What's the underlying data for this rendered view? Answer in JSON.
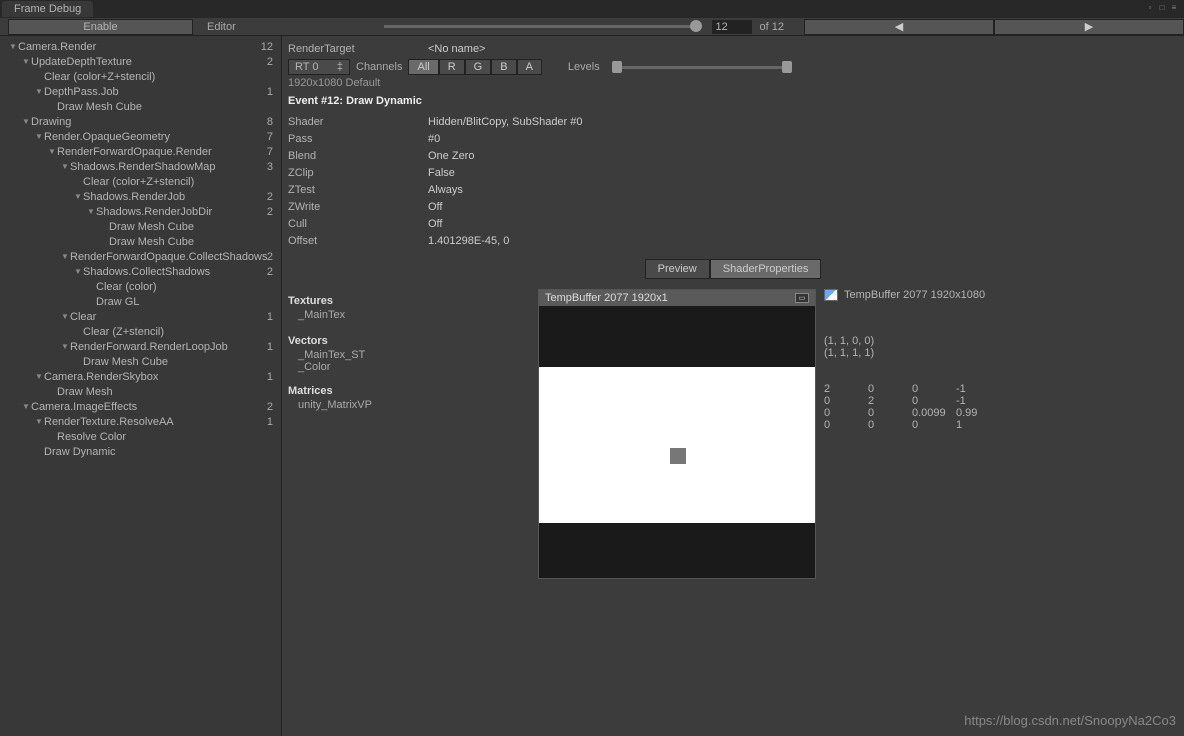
{
  "tab_title": "Frame Debug",
  "toolbar": {
    "enable_label": "Enable",
    "editor_label": "Editor",
    "frame_current": "12",
    "frame_total": "of 12",
    "prev_arrow": "◀",
    "next_arrow": "▶"
  },
  "tree": [
    {
      "indent": 0,
      "arrow": true,
      "label": "Camera.Render",
      "count": "12"
    },
    {
      "indent": 1,
      "arrow": true,
      "label": "UpdateDepthTexture",
      "count": "2"
    },
    {
      "indent": 2,
      "arrow": false,
      "label": "Clear (color+Z+stencil)",
      "count": ""
    },
    {
      "indent": 2,
      "arrow": true,
      "label": "DepthPass.Job",
      "count": "1"
    },
    {
      "indent": 3,
      "arrow": false,
      "label": "Draw Mesh Cube",
      "count": ""
    },
    {
      "indent": 1,
      "arrow": true,
      "label": "Drawing",
      "count": "8"
    },
    {
      "indent": 2,
      "arrow": true,
      "label": "Render.OpaqueGeometry",
      "count": "7"
    },
    {
      "indent": 3,
      "arrow": true,
      "label": "RenderForwardOpaque.Render",
      "count": "7"
    },
    {
      "indent": 4,
      "arrow": true,
      "label": "Shadows.RenderShadowMap",
      "count": "3"
    },
    {
      "indent": 5,
      "arrow": false,
      "label": "Clear (color+Z+stencil)",
      "count": ""
    },
    {
      "indent": 5,
      "arrow": true,
      "label": "Shadows.RenderJob",
      "count": "2"
    },
    {
      "indent": 6,
      "arrow": true,
      "label": "Shadows.RenderJobDir",
      "count": "2"
    },
    {
      "indent": 7,
      "arrow": false,
      "label": "Draw Mesh Cube",
      "count": ""
    },
    {
      "indent": 7,
      "arrow": false,
      "label": "Draw Mesh Cube",
      "count": ""
    },
    {
      "indent": 4,
      "arrow": true,
      "label": "RenderForwardOpaque.CollectShadows",
      "count": "2"
    },
    {
      "indent": 5,
      "arrow": true,
      "label": "Shadows.CollectShadows",
      "count": "2"
    },
    {
      "indent": 6,
      "arrow": false,
      "label": "Clear (color)",
      "count": ""
    },
    {
      "indent": 6,
      "arrow": false,
      "label": "Draw GL",
      "count": ""
    },
    {
      "indent": 4,
      "arrow": true,
      "label": "Clear",
      "count": "1"
    },
    {
      "indent": 5,
      "arrow": false,
      "label": "Clear (Z+stencil)",
      "count": ""
    },
    {
      "indent": 4,
      "arrow": true,
      "label": "RenderForward.RenderLoopJob",
      "count": "1"
    },
    {
      "indent": 5,
      "arrow": false,
      "label": "Draw Mesh Cube",
      "count": ""
    },
    {
      "indent": 2,
      "arrow": true,
      "label": "Camera.RenderSkybox",
      "count": "1"
    },
    {
      "indent": 3,
      "arrow": false,
      "label": "Draw Mesh",
      "count": ""
    },
    {
      "indent": 1,
      "arrow": true,
      "label": "Camera.ImageEffects",
      "count": "2"
    },
    {
      "indent": 2,
      "arrow": true,
      "label": "RenderTexture.ResolveAA",
      "count": "1"
    },
    {
      "indent": 3,
      "arrow": false,
      "label": "Resolve Color",
      "count": ""
    },
    {
      "indent": 2,
      "arrow": false,
      "label": "Draw Dynamic",
      "count": ""
    }
  ],
  "detail": {
    "render_target_label": "RenderTarget",
    "render_target_value": "<No name>",
    "rt_dropdown": "RT 0",
    "channels_label": "Channels",
    "channels": [
      "All",
      "R",
      "G",
      "B",
      "A"
    ],
    "levels_label": "Levels",
    "resolution": "1920x1080 Default",
    "event_title": "Event #12: Draw Dynamic",
    "props": [
      {
        "label": "Shader",
        "value": "Hidden/BlitCopy, SubShader #0"
      },
      {
        "label": "Pass",
        "value": "#0"
      },
      {
        "label": "Blend",
        "value": "One Zero"
      },
      {
        "label": "ZClip",
        "value": "False"
      },
      {
        "label": "ZTest",
        "value": "Always"
      },
      {
        "label": "ZWrite",
        "value": "Off"
      },
      {
        "label": "Cull",
        "value": "Off"
      },
      {
        "label": "Offset",
        "value": "1.401298E-45, 0"
      }
    ],
    "tabs": {
      "preview": "Preview",
      "shader_props": "ShaderProperties"
    },
    "textures_header": "Textures",
    "maintex": "_MainTex",
    "preview_title": "TempBuffer 2077 1920x1",
    "rt_name": "TempBuffer 2077 1920x1080",
    "vectors_header": "Vectors",
    "maintex_st": "_MainTex_ST",
    "maintex_st_val": "(1, 1, 0, 0)",
    "color": "_Color",
    "color_val": "(1, 1, 1, 1)",
    "matrices_header": "Matrices",
    "matrixvp": "unity_MatrixVP",
    "matrix": [
      [
        "2",
        "0",
        "0",
        "-1"
      ],
      [
        "0",
        "2",
        "0",
        "-1"
      ],
      [
        "0",
        "0",
        "0.0099",
        "0.99"
      ],
      [
        "0",
        "0",
        "0",
        "1"
      ]
    ]
  },
  "watermark": "https://blog.csdn.net/SnoopyNa2Co3"
}
